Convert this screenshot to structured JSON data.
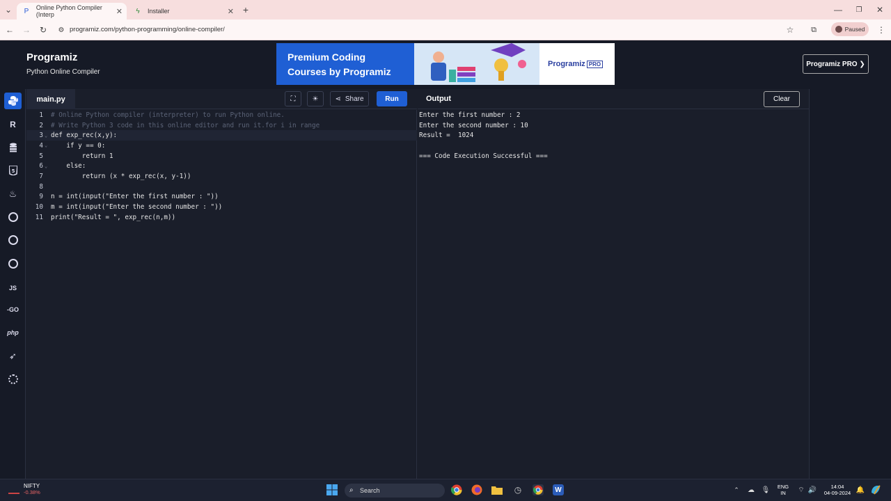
{
  "browser": {
    "tabs": [
      {
        "title": "Online Python Compiler (Interp",
        "active": true
      },
      {
        "title": "Installer",
        "active": false
      }
    ],
    "url": "programiz.com/python-programming/online-compiler/",
    "profile_label": "Paused"
  },
  "site": {
    "logo": "Programiz",
    "subtitle": "Python Online Compiler",
    "banner": {
      "line1": "Premium Coding",
      "line2": "Courses by Programiz",
      "brand": "Programiz",
      "badge": "PRO"
    },
    "pro_button": "Programiz PRO ❯"
  },
  "languages": [
    {
      "name": "python-icon",
      "label": ""
    },
    {
      "name": "r-icon",
      "label": "R"
    },
    {
      "name": "sql-icon",
      "label": ""
    },
    {
      "name": "html-icon",
      "label": "5"
    },
    {
      "name": "java-icon",
      "label": ""
    },
    {
      "name": "c-icon",
      "label": ""
    },
    {
      "name": "cpp-icon",
      "label": ""
    },
    {
      "name": "csharp-icon",
      "label": ""
    },
    {
      "name": "js-icon",
      "label": "JS"
    },
    {
      "name": "go-icon",
      "label": "-GO"
    },
    {
      "name": "php-icon",
      "label": "php"
    },
    {
      "name": "swift-icon",
      "label": ""
    },
    {
      "name": "rust-icon",
      "label": ""
    }
  ],
  "editor": {
    "filename": "main.py",
    "share_label": "Share",
    "run_label": "Run",
    "lines": [
      "# Online Python compiler (interpreter) to run Python online.",
      "# Write Python 3 code in this online editor and run it.for i in range",
      "def exp_rec(x,y):",
      "    if y == 0:",
      "        return 1",
      "    else:",
      "        return (x * exp_rec(x, y-1))",
      "",
      "n = int(input(\"Enter the first number : \"))",
      "m = int(input(\"Enter the second number : \"))",
      "print(\"Result = \", exp_rec(n,m))"
    ]
  },
  "output": {
    "label": "Output",
    "clear_label": "Clear",
    "lines": [
      "Enter the first number : 2",
      "Enter the second number : 10",
      "Result =  1024",
      "",
      "=== Code Execution Successful ==="
    ]
  },
  "taskbar": {
    "ticker_name": "NIFTY",
    "ticker_change": "-0.38%",
    "search_placeholder": "Search",
    "lang_top": "ENG",
    "lang_bottom": "IN",
    "time": "14:04",
    "date": "04-09-2024"
  }
}
